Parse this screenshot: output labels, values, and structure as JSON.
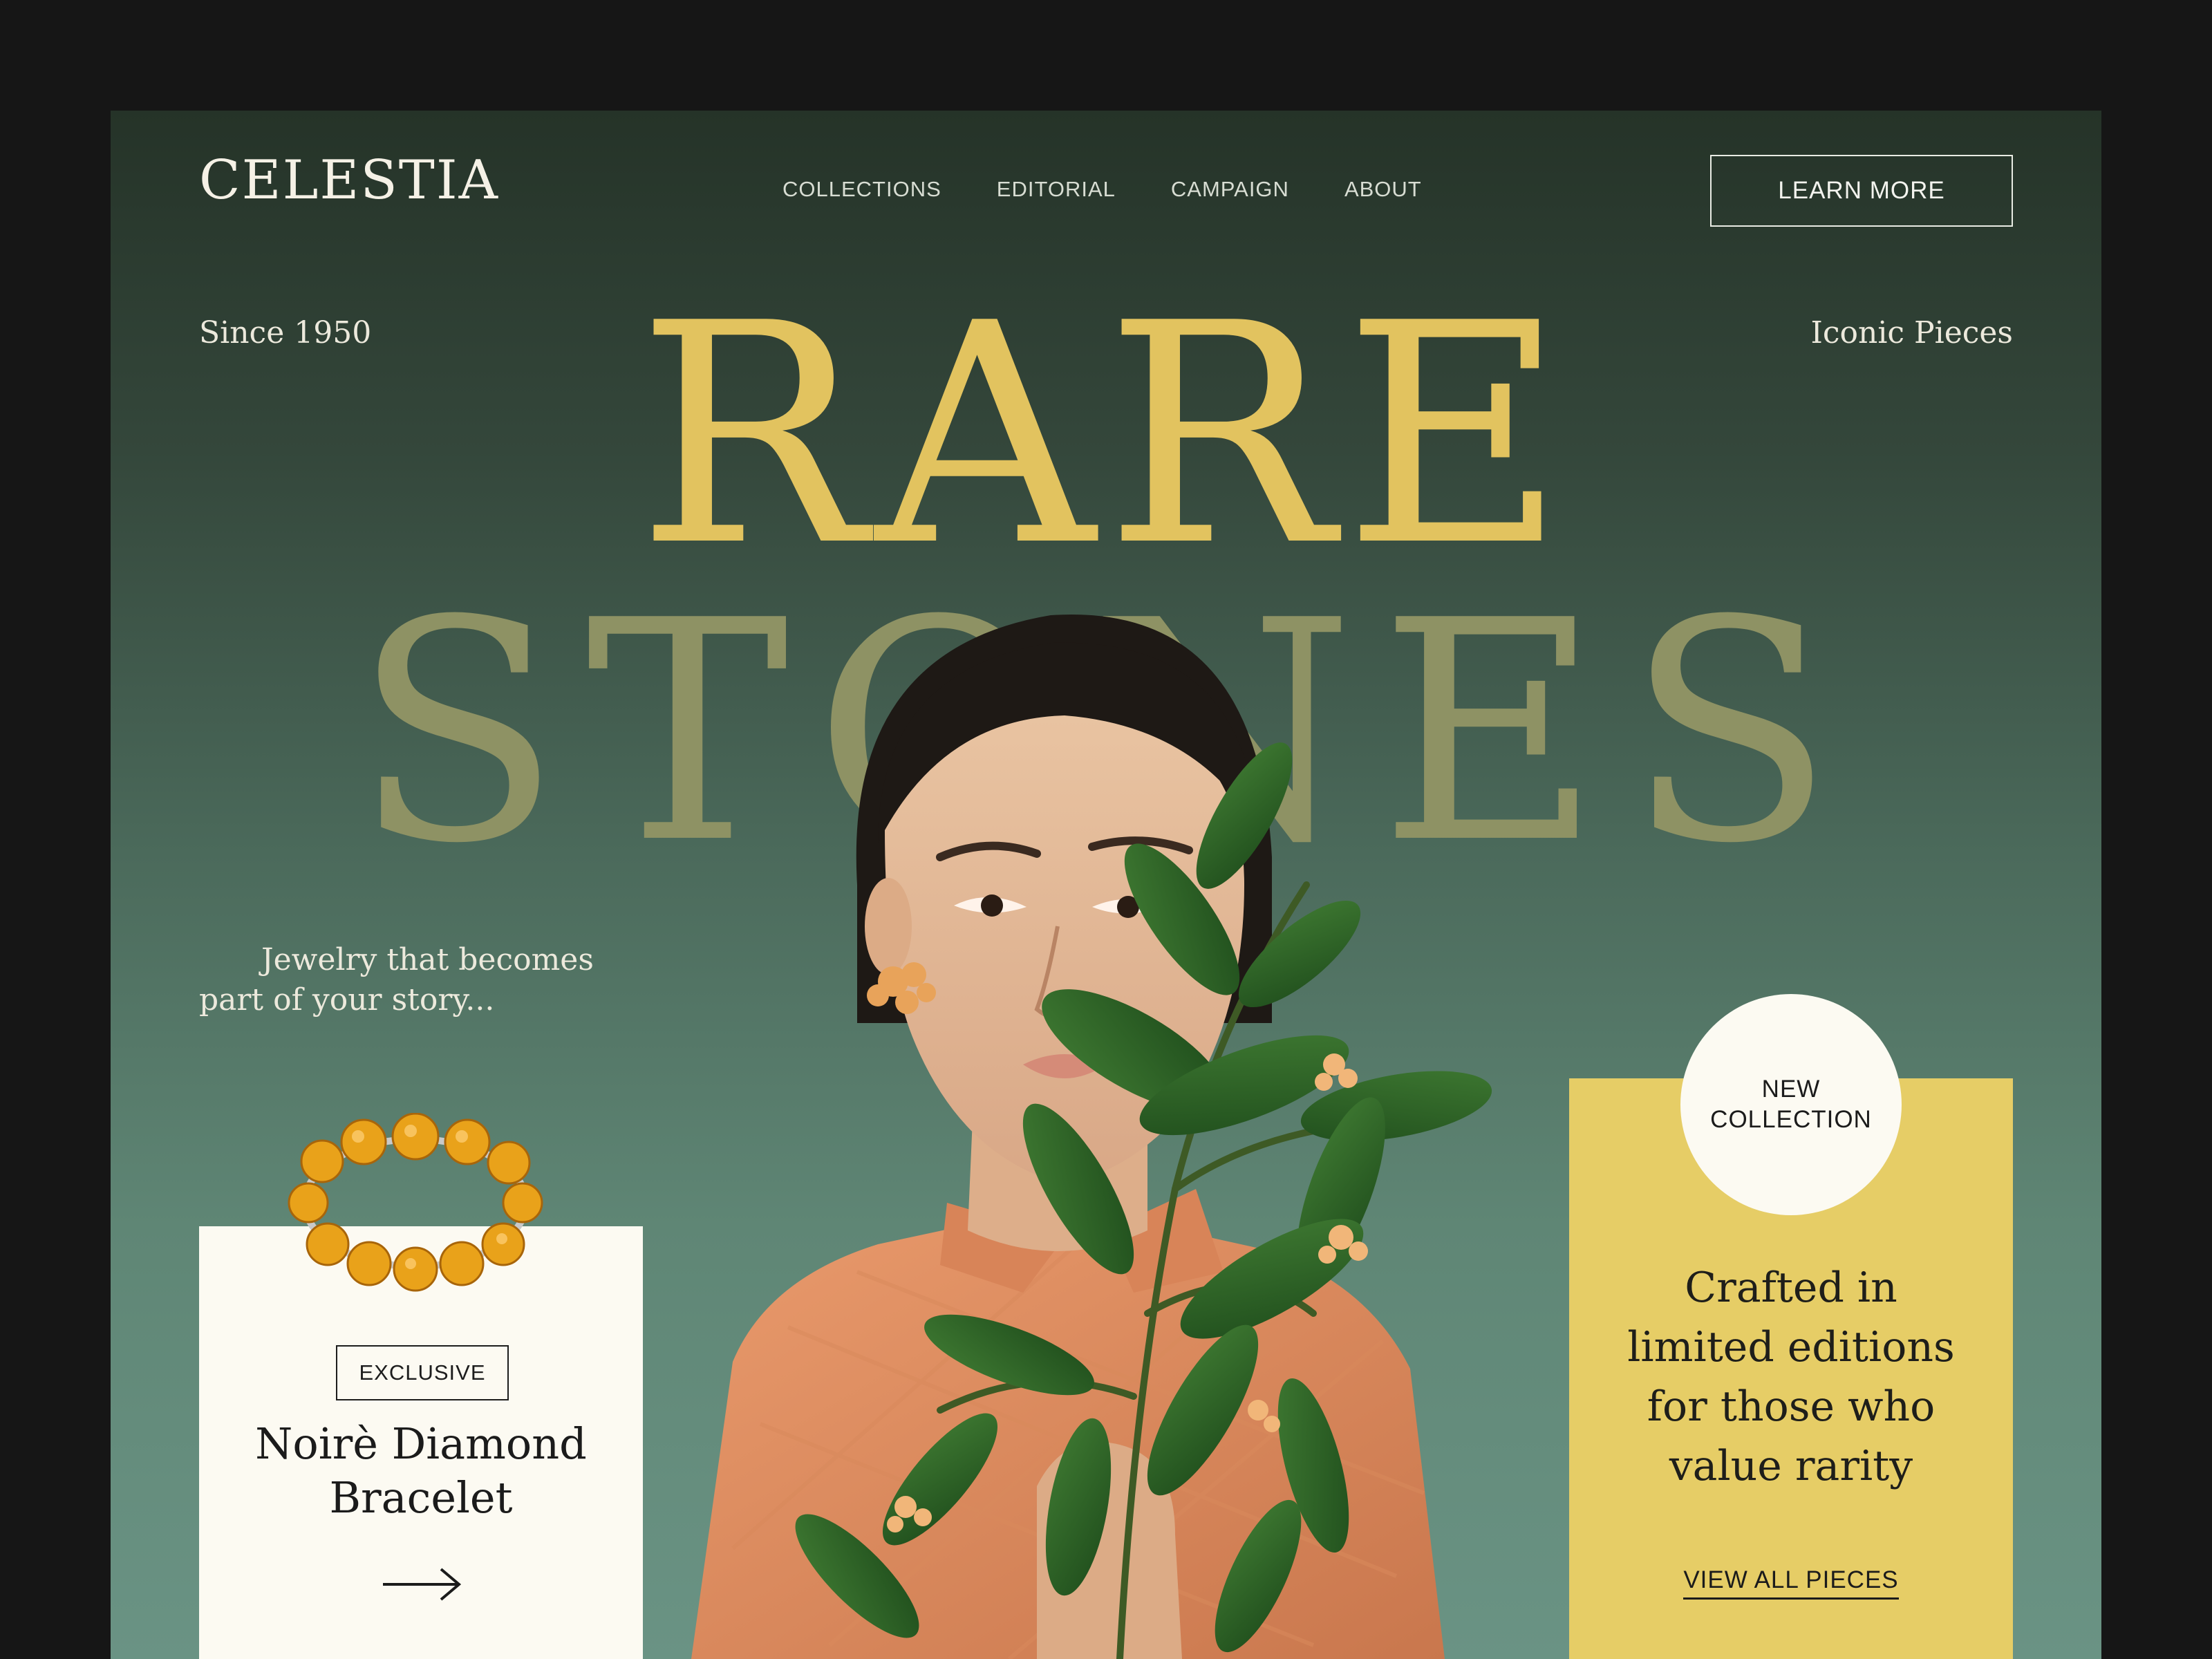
{
  "brand": {
    "logo": "CELESTIA"
  },
  "nav": {
    "items": [
      {
        "label": "COLLECTIONS"
      },
      {
        "label": "EDITORIAL"
      },
      {
        "label": "CAMPAIGN"
      },
      {
        "label": "ABOUT"
      }
    ],
    "cta_label": "LEARN MORE"
  },
  "hero": {
    "since": "Since 1950",
    "iconic": "Iconic Pieces",
    "headline_line1": "RARE",
    "headline_line2": "STONES",
    "tagline": "Jewelry that becomes part of your story..."
  },
  "exclusive_card": {
    "badge": "EXCLUSIVE",
    "product_name_line1": "Noirè Diamond",
    "product_name_line2": "Bracelet",
    "arrow_icon": "arrow-right-icon"
  },
  "collection_card": {
    "badge_line1": "NEW",
    "badge_line2": "COLLECTION",
    "text_line1": "Crafted in",
    "text_line2": "limited editions",
    "text_line3": "for those who",
    "text_line4": "value rarity",
    "link_label": "VIEW ALL PIECES"
  },
  "colors": {
    "page_background": "#161616",
    "hero_green_dark": "#253328",
    "hero_green_light": "#6a9384",
    "gold": "#e2c35f",
    "cream": "#fcfaf2",
    "card_yellow": "#e6cd66"
  }
}
